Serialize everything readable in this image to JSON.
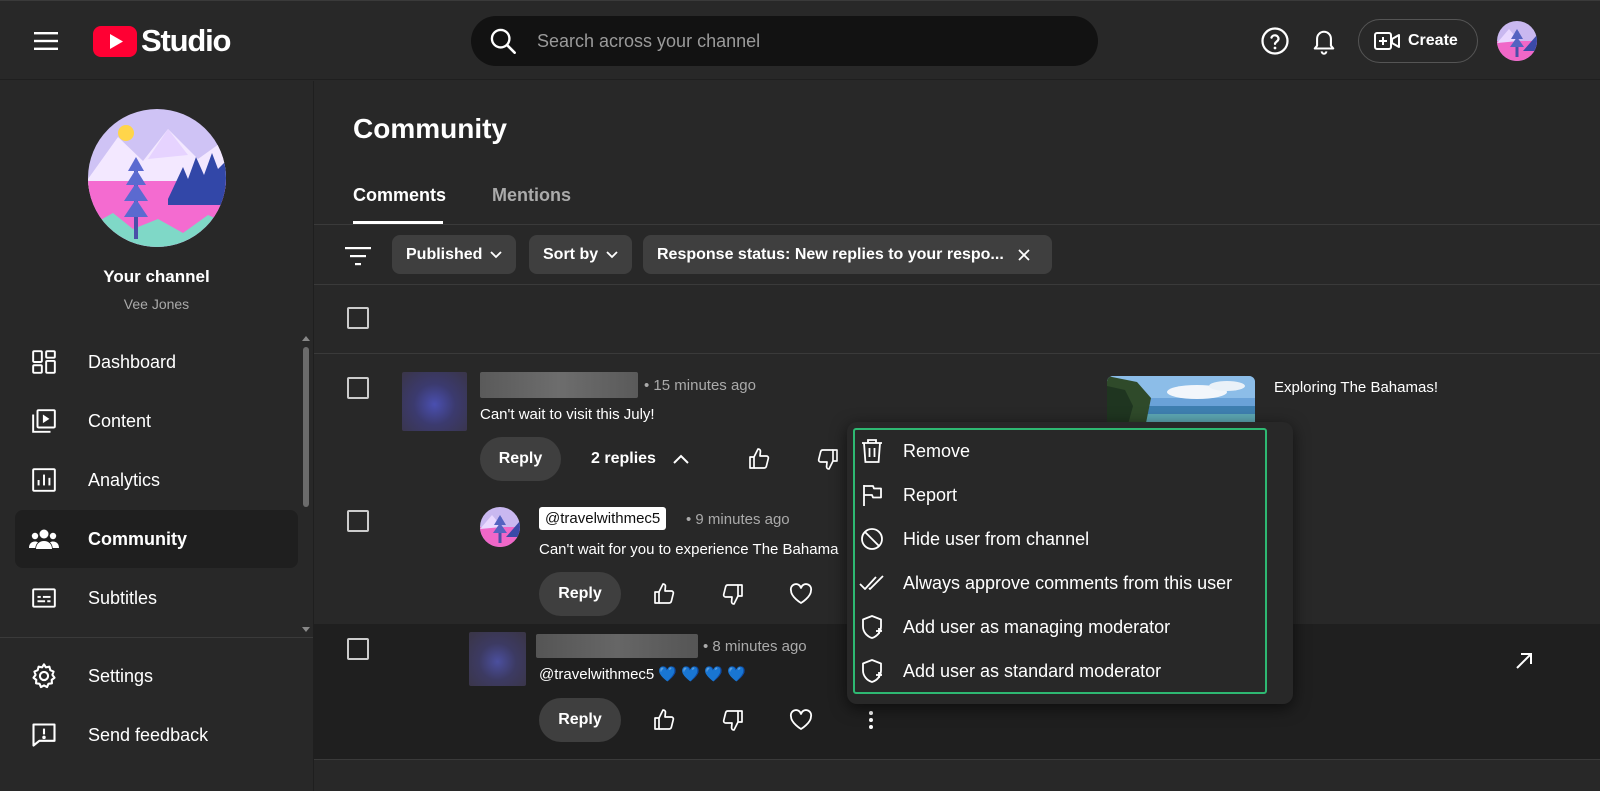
{
  "header": {
    "logo_text": "Studio",
    "search_placeholder": "Search across your channel",
    "create_label": "Create"
  },
  "sidebar": {
    "channel_title": "Your channel",
    "channel_name": "Vee Jones",
    "items": [
      {
        "label": "Dashboard",
        "icon": "dashboard-icon"
      },
      {
        "label": "Content",
        "icon": "content-icon"
      },
      {
        "label": "Analytics",
        "icon": "analytics-icon"
      },
      {
        "label": "Community",
        "icon": "community-icon",
        "active": true
      },
      {
        "label": "Subtitles",
        "icon": "subtitles-icon"
      }
    ],
    "bottom_items": [
      {
        "label": "Settings",
        "icon": "gear-icon"
      },
      {
        "label": "Send feedback",
        "icon": "feedback-icon"
      }
    ]
  },
  "main": {
    "title": "Community",
    "tabs": [
      {
        "label": "Comments",
        "active": true
      },
      {
        "label": "Mentions",
        "active": false
      }
    ],
    "filters": [
      {
        "label": "Published"
      },
      {
        "label": "Sort by"
      },
      {
        "label": "Response status: New replies to your respo..."
      }
    ],
    "comments": [
      {
        "time": "15 minutes ago",
        "text": "Can't wait to visit this July!",
        "reply_label": "Reply",
        "replies_label": "2 replies"
      },
      {
        "author": "@travelwithmec5",
        "time": "9 minutes ago",
        "text": "Can't wait for you to experience The Bahama",
        "reply_label": "Reply"
      },
      {
        "time": "8 minutes ago",
        "text": "@travelwithmec5 💙 💙 💙 💙",
        "reply_label": "Reply"
      }
    ],
    "video": {
      "title": "Exploring The Bahamas!"
    }
  },
  "context_menu": {
    "items": [
      {
        "label": "Remove",
        "icon": "trash-icon"
      },
      {
        "label": "Report",
        "icon": "flag-icon"
      },
      {
        "label": "Hide user from channel",
        "icon": "block-icon"
      },
      {
        "label": "Always approve comments from this user",
        "icon": "double-check-icon"
      },
      {
        "label": "Add user as managing moderator",
        "icon": "shield-add-icon"
      },
      {
        "label": "Add user as standard moderator",
        "icon": "shield-add-icon"
      }
    ]
  },
  "colors": {
    "background": "#282828",
    "accent_red": "#ff0033",
    "menu_highlight": "#2eb872"
  }
}
